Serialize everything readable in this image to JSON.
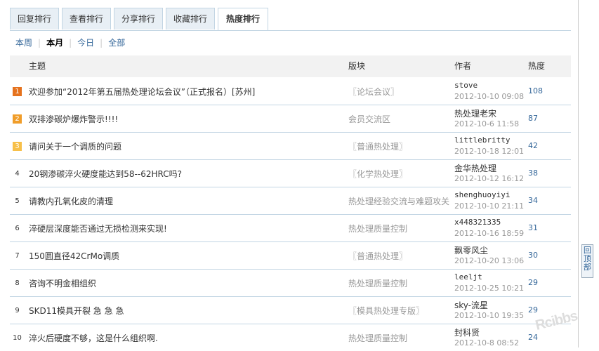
{
  "tabs": [
    {
      "label": "回复排行"
    },
    {
      "label": "查看排行"
    },
    {
      "label": "分享排行"
    },
    {
      "label": "收藏排行"
    },
    {
      "label": "热度排行",
      "active": true
    }
  ],
  "filters": [
    {
      "label": "本周"
    },
    {
      "label": "本月",
      "active": true
    },
    {
      "label": "今日"
    },
    {
      "label": "全部"
    }
  ],
  "table": {
    "headers": {
      "subject": "主题",
      "forum": "版块",
      "author": "作者",
      "heat": "热度"
    },
    "rows": [
      {
        "rank": "1",
        "subject": "欢迎参加“2012年第五届热处理论坛会议”（正式报名）[苏州]",
        "forum": "〖论坛会议〗",
        "author": "stove",
        "date": "2012-10-10 09:08",
        "heat": "108"
      },
      {
        "rank": "2",
        "subject": "双排渗碳炉爆炸警示!!!!",
        "forum": "会员交流区",
        "author": "热处理老宋",
        "date": "2012-10-6 11:58",
        "heat": "87"
      },
      {
        "rank": "3",
        "subject": "请问关于一个调质的问题",
        "forum": "〖普通热处理〗",
        "author": "littlebritty",
        "date": "2012-10-18 12:01",
        "heat": "42"
      },
      {
        "rank": "4",
        "subject": "20钢渗碳淬火硬度能达到58--62HRC吗?",
        "forum": "〖化学热处理〗",
        "author": "金华热处理",
        "date": "2012-10-12 16:12",
        "heat": "38"
      },
      {
        "rank": "5",
        "subject": "请教内孔氧化皮的清理",
        "forum": "热处理经验交流与难题攻关",
        "author": "shenghuoyiyi",
        "date": "2012-10-10 21:11",
        "heat": "34"
      },
      {
        "rank": "6",
        "subject": "淬硬层深度能否通过无损检测来实现!",
        "forum": "热处理质量控制",
        "author": "x448321335",
        "date": "2012-10-16 18:59",
        "heat": "31"
      },
      {
        "rank": "7",
        "subject": "150圆直径42CrMo调质",
        "forum": "〖普通热处理〗",
        "author": "飘零风尘",
        "date": "2012-10-20 13:06",
        "heat": "30"
      },
      {
        "rank": "8",
        "subject": "咨询不明金相组织",
        "forum": "热处理质量控制",
        "author": "leeljt",
        "date": "2012-10-25 10:21",
        "heat": "29"
      },
      {
        "rank": "9",
        "subject": "SKD11模具开裂 急 急 急",
        "forum": "〖模具热处理专版〗",
        "author": "sky-流星",
        "date": "2012-10-10 19:35",
        "heat": "29"
      },
      {
        "rank": "10",
        "subject": "淬火后硬度不够，这是什么组织啊.",
        "forum": "热处理质量控制",
        "author": "封科贤",
        "date": "2012-10-8 08:52",
        "heat": "24"
      }
    ]
  },
  "back_to_top": "回顶部",
  "watermark": "Rcibbs"
}
